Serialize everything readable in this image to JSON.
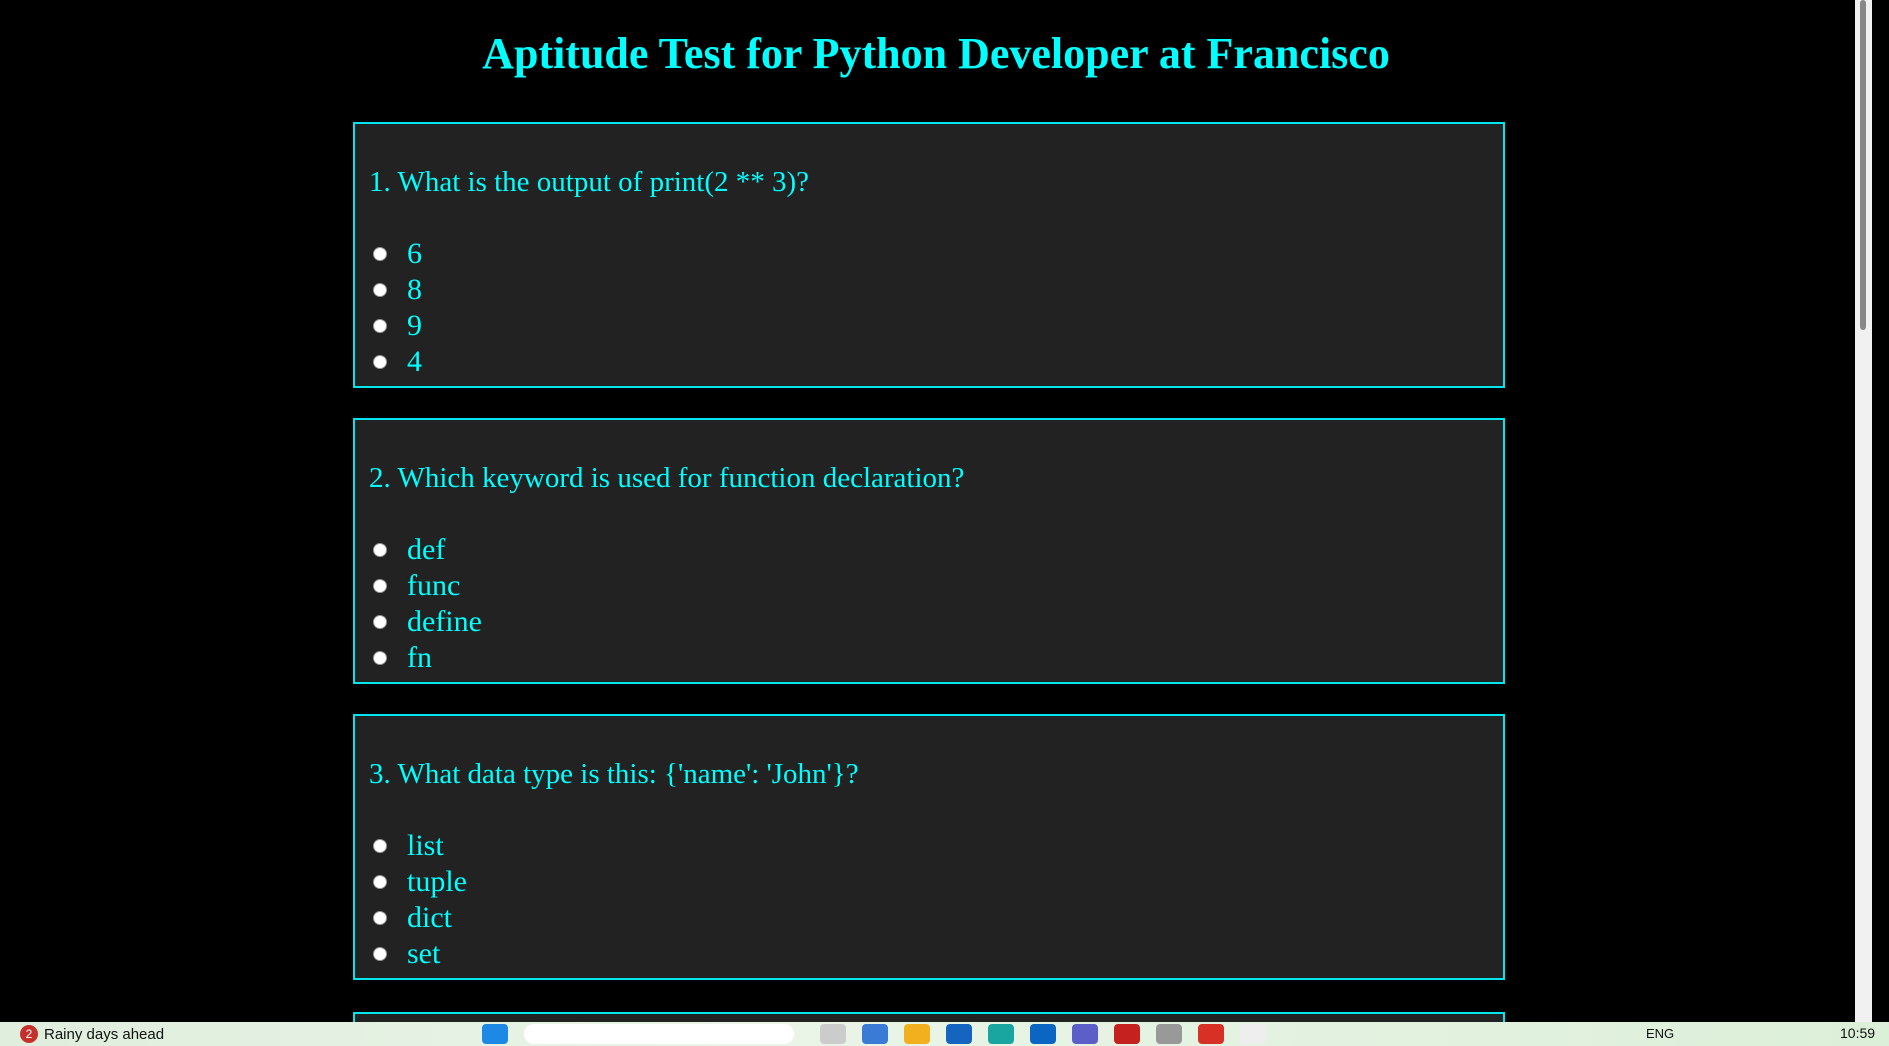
{
  "title": "Aptitude Test for Python Developer at Francisco",
  "questions": [
    {
      "text": "1. What is the output of print(2 ** 3)?",
      "options": [
        "6",
        "8",
        "9",
        "4"
      ]
    },
    {
      "text": "2. Which keyword is used for function declaration?",
      "options": [
        "def",
        "func",
        "define",
        "fn"
      ]
    },
    {
      "text": "3. What data type is this: {'name': 'John'}?",
      "options": [
        "list",
        "tuple",
        "dict",
        "set"
      ]
    }
  ],
  "taskbar": {
    "weather_badge": "2",
    "weather_text": "Rainy days ahead",
    "language": "ENG",
    "time": "10:59",
    "icons": [
      "windows-start-icon",
      "search-box",
      "file-explorer-icon",
      "edge-icon",
      "folder-icon",
      "store-icon",
      "browser-icon",
      "outlook-icon",
      "teams-icon",
      "gmail-icon",
      "database-icon",
      "chrome-icon",
      "document-icon"
    ]
  },
  "colors": {
    "accent": "#00ffff",
    "card": "#222222",
    "background": "#000000"
  }
}
